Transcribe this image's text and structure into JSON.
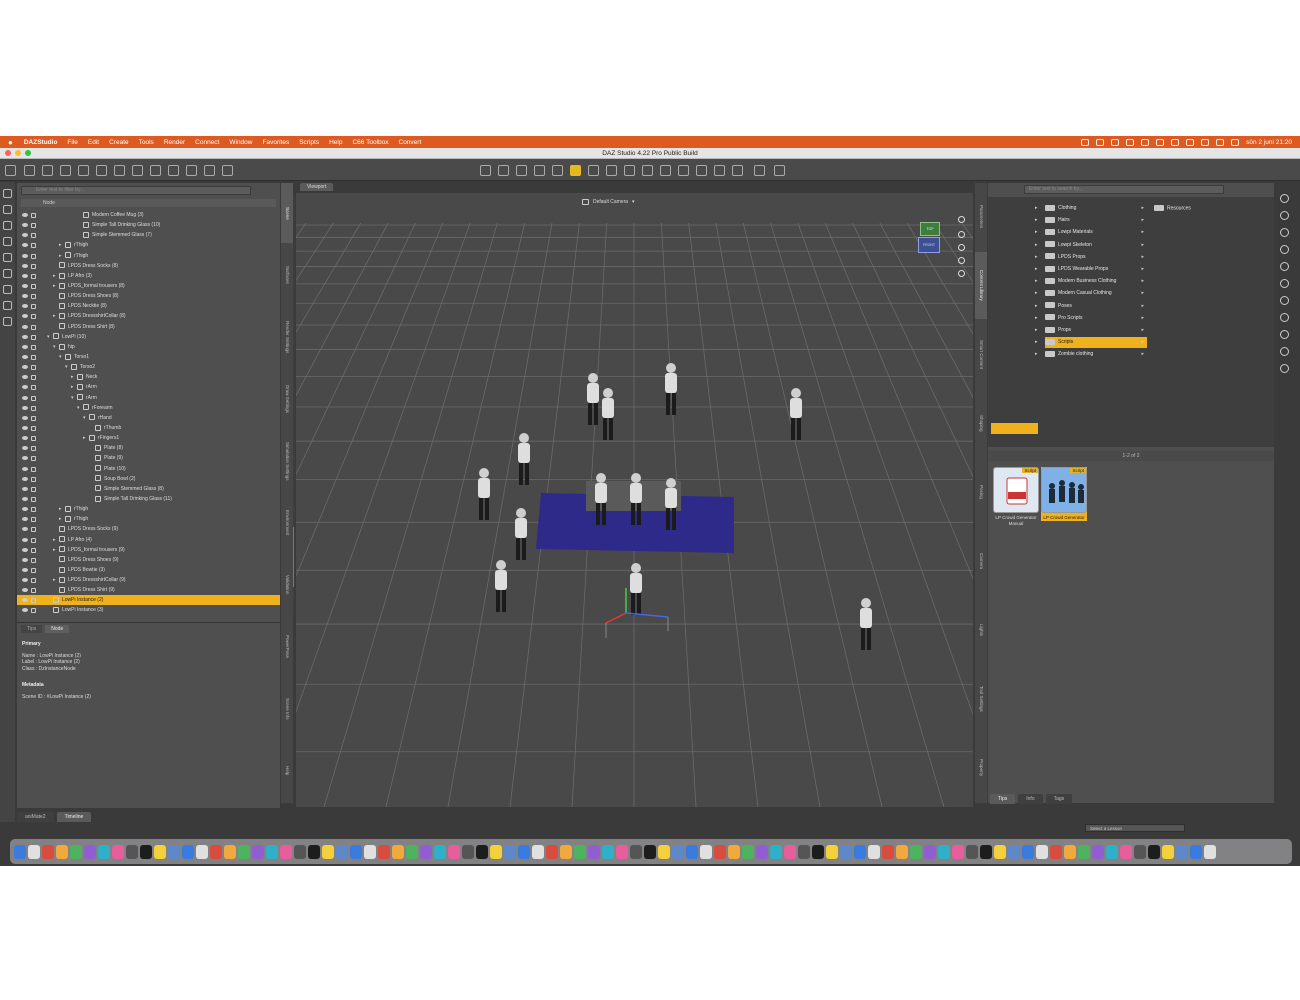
{
  "menubar": {
    "app": "DAZStudio",
    "items": [
      "File",
      "Edit",
      "Create",
      "Tools",
      "Render",
      "Connect",
      "Window",
      "Favorites",
      "Scripts",
      "Help",
      "C66 Toolbox",
      "Convert"
    ],
    "clock": "sön 2 juni 21:20"
  },
  "window": {
    "title": "DAZ Studio 4.22 Pro Public Build"
  },
  "scene": {
    "search_placeholder": "Enter text to filter by...",
    "column_header": "Node",
    "nodes": [
      {
        "label": "Modern Coffee Mug (3)",
        "depth": 6,
        "arrow": "",
        "selected": false
      },
      {
        "label": "Simple Tall Drinking Glass (10)",
        "depth": 6,
        "arrow": "",
        "selected": false
      },
      {
        "label": "Simple Stemmed Glass (7)",
        "depth": 6,
        "arrow": "",
        "selected": false
      },
      {
        "label": "rThigh",
        "depth": 3,
        "arrow": "▸",
        "selected": false
      },
      {
        "label": "rThigh",
        "depth": 3,
        "arrow": "▸",
        "selected": false
      },
      {
        "label": "LPDS Dress Socks (8)",
        "depth": 2,
        "arrow": "",
        "selected": false
      },
      {
        "label": "LP Afro (3)",
        "depth": 2,
        "arrow": "▸",
        "selected": false
      },
      {
        "label": "LPDS_formal trousers (8)",
        "depth": 2,
        "arrow": "▸",
        "selected": false
      },
      {
        "label": "LPDS Dress Shoes (8)",
        "depth": 2,
        "arrow": "",
        "selected": false
      },
      {
        "label": "LPDS Necktie (8)",
        "depth": 2,
        "arrow": "",
        "selected": false
      },
      {
        "label": "LPDS DressshirtCollar (8)",
        "depth": 2,
        "arrow": "▸",
        "selected": false
      },
      {
        "label": "LPDS Dress Shirt (8)",
        "depth": 2,
        "arrow": "",
        "selected": false
      },
      {
        "label": "LowPi (10)",
        "depth": 1,
        "arrow": "▾",
        "selected": false
      },
      {
        "label": "hip",
        "depth": 2,
        "arrow": "▾",
        "selected": false
      },
      {
        "label": "Torso1",
        "depth": 3,
        "arrow": "▾",
        "selected": false
      },
      {
        "label": "Torso2",
        "depth": 4,
        "arrow": "▾",
        "selected": false
      },
      {
        "label": "Neck",
        "depth": 5,
        "arrow": "▸",
        "selected": false
      },
      {
        "label": "rArm",
        "depth": 5,
        "arrow": "▸",
        "selected": false
      },
      {
        "label": "rArm",
        "depth": 5,
        "arrow": "▾",
        "selected": false
      },
      {
        "label": "rForearm",
        "depth": 6,
        "arrow": "▾",
        "selected": false
      },
      {
        "label": "rHand",
        "depth": 7,
        "arrow": "▾",
        "selected": false
      },
      {
        "label": "rThumb",
        "depth": 8,
        "arrow": "",
        "selected": false
      },
      {
        "label": "rFingers1",
        "depth": 7,
        "arrow": "▸",
        "selected": false
      },
      {
        "label": "Plate (8)",
        "depth": 8,
        "arrow": "",
        "selected": false
      },
      {
        "label": "Plate (9)",
        "depth": 8,
        "arrow": "",
        "selected": false
      },
      {
        "label": "Plate (10)",
        "depth": 8,
        "arrow": "",
        "selected": false
      },
      {
        "label": "Soup Bowl (2)",
        "depth": 8,
        "arrow": "",
        "selected": false
      },
      {
        "label": "Simple Stemmed Glass (8)",
        "depth": 8,
        "arrow": "",
        "selected": false
      },
      {
        "label": "Simple Tall Drinking Glass (11)",
        "depth": 8,
        "arrow": "",
        "selected": false
      },
      {
        "label": "rThigh",
        "depth": 3,
        "arrow": "▸",
        "selected": false
      },
      {
        "label": "rThigh",
        "depth": 3,
        "arrow": "▸",
        "selected": false
      },
      {
        "label": "LPDS Dress Socks (9)",
        "depth": 2,
        "arrow": "",
        "selected": false
      },
      {
        "label": "LP Afro (4)",
        "depth": 2,
        "arrow": "▸",
        "selected": false
      },
      {
        "label": "LPDS_formal trousers (9)",
        "depth": 2,
        "arrow": "▸",
        "selected": false
      },
      {
        "label": "LPDS Dress Shoes (9)",
        "depth": 2,
        "arrow": "",
        "selected": false
      },
      {
        "label": "LPDS Bowtie (3)",
        "depth": 2,
        "arrow": "",
        "selected": false
      },
      {
        "label": "LPDS DressshirtCollar (9)",
        "depth": 2,
        "arrow": "▸",
        "selected": false
      },
      {
        "label": "LPDS Dress Shirt (9)",
        "depth": 2,
        "arrow": "",
        "selected": false
      },
      {
        "label": "LowPi Instance (2)",
        "depth": 1,
        "arrow": "",
        "selected": true
      },
      {
        "label": "LowPi Instance (3)",
        "depth": 1,
        "arrow": "",
        "selected": false
      }
    ]
  },
  "param": {
    "tabs": [
      "Tips",
      "Node"
    ],
    "active_tab": "Node",
    "primary_heading": "Primary",
    "name_line": "Name : LowPi Instance (2)",
    "label_line": "Label : LowPi Instance (2)",
    "class_line": "Class : DzInstanceNode",
    "metadata_heading": "Metadata",
    "scene_id_line": "Scene ID : #LowPi Instance (2)"
  },
  "bottom_tabs": [
    "aniMate2",
    "Timeline"
  ],
  "bottom_right_select": "Select a Lesson",
  "left_vtabs": [
    "Scene",
    "Surfaces",
    "Render Settings",
    "Draw Settings",
    "Simulation Settings",
    "Environment",
    "Validation",
    "PowerPose",
    "Scene Info",
    "Help"
  ],
  "viewport": {
    "tab": "Viewport",
    "camera": "Default Camera",
    "cube_top": "TOP",
    "cube_front": "FRONT"
  },
  "right_vtabs": [
    "Parameters",
    "Content Library",
    "Smart Content",
    "Shaping",
    "Posing",
    "Camera",
    "Lights",
    "Tool Settings",
    "Property"
  ],
  "library": {
    "search_placeholder": "Enter text to search by...",
    "folders": [
      "Clothing",
      "Hairs",
      "Lowpi Materials",
      "Lowpi Skeleton",
      "LPDS Props",
      "LPDS Wearable Props",
      "Modern Business Clothing",
      "Modern Casual Clothing",
      "Poses",
      "Pro Scripts",
      "Props",
      "Scripts",
      "Zombie clothing"
    ],
    "selected_folder": "Scripts",
    "resources_label": "Resources",
    "pager": "1-2 of 2",
    "tiles": [
      {
        "badge": "Script",
        "caption": "LP Crowd Generator Manual",
        "selected": false
      },
      {
        "badge": "Script",
        "caption": "LP Crowd Generator",
        "selected": true
      }
    ],
    "bottom_tabs": [
      "Tips",
      "Info",
      "Tags"
    ]
  }
}
